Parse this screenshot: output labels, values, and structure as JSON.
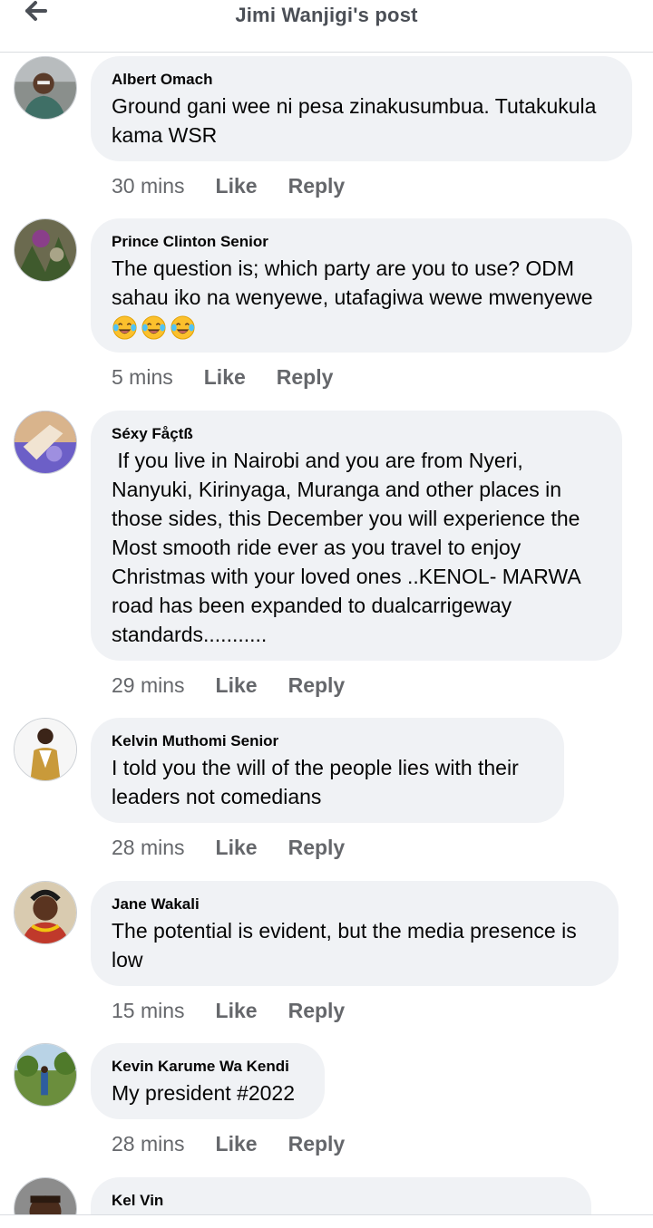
{
  "header": {
    "title": "Jimi Wanjigi's post",
    "back_icon": "arrow-left-icon"
  },
  "labels": {
    "like": "Like",
    "reply": "Reply"
  },
  "colors": {
    "bubble": "#f0f2f5",
    "secondary_text": "#65676b",
    "header_text": "#4b4f56"
  },
  "comments": [
    {
      "author": "Albert Omach",
      "text": "Ground gani wee ni pesa zinakusumbua. Tutakukula\nkama WSR",
      "time": "30 mins"
    },
    {
      "author": "Prince Clinton Senior",
      "text": "The question is; which party are you to use? ODM\nsahau iko na wenyewe, utafagiwa wewe mwenyewe",
      "emojis": [
        "laughing-tears-emoji",
        "laughing-tears-emoji",
        "laughing-tears-emoji"
      ],
      "time": "5 mins"
    },
    {
      "author": "Séxy Fåçtß",
      "text": " If you live in Nairobi and you are from Nyeri,\nNanyuki, Kirinyaga, Muranga and other places in\nthose sides, this December you will experience the\nMost smooth ride ever as you travel to enjoy\nChristmas with your loved ones ..KENOL- MARWA\nroad has been expanded to dualcarrigeway\nstandards...........",
      "time": "29 mins"
    },
    {
      "author": "Kelvin Muthomi Senior",
      "text": "I told you the will of the people lies with their\nleaders not comedians",
      "time": "28 mins"
    },
    {
      "author": "Jane Wakali",
      "text": "The potential is evident, but the media presence is\nlow",
      "time": "15 mins"
    },
    {
      "author": "Kevin Karume Wa Kendi",
      "text": "My president #2022",
      "time": "28 mins"
    },
    {
      "author": "Kel Vin",
      "text": ""
    }
  ]
}
